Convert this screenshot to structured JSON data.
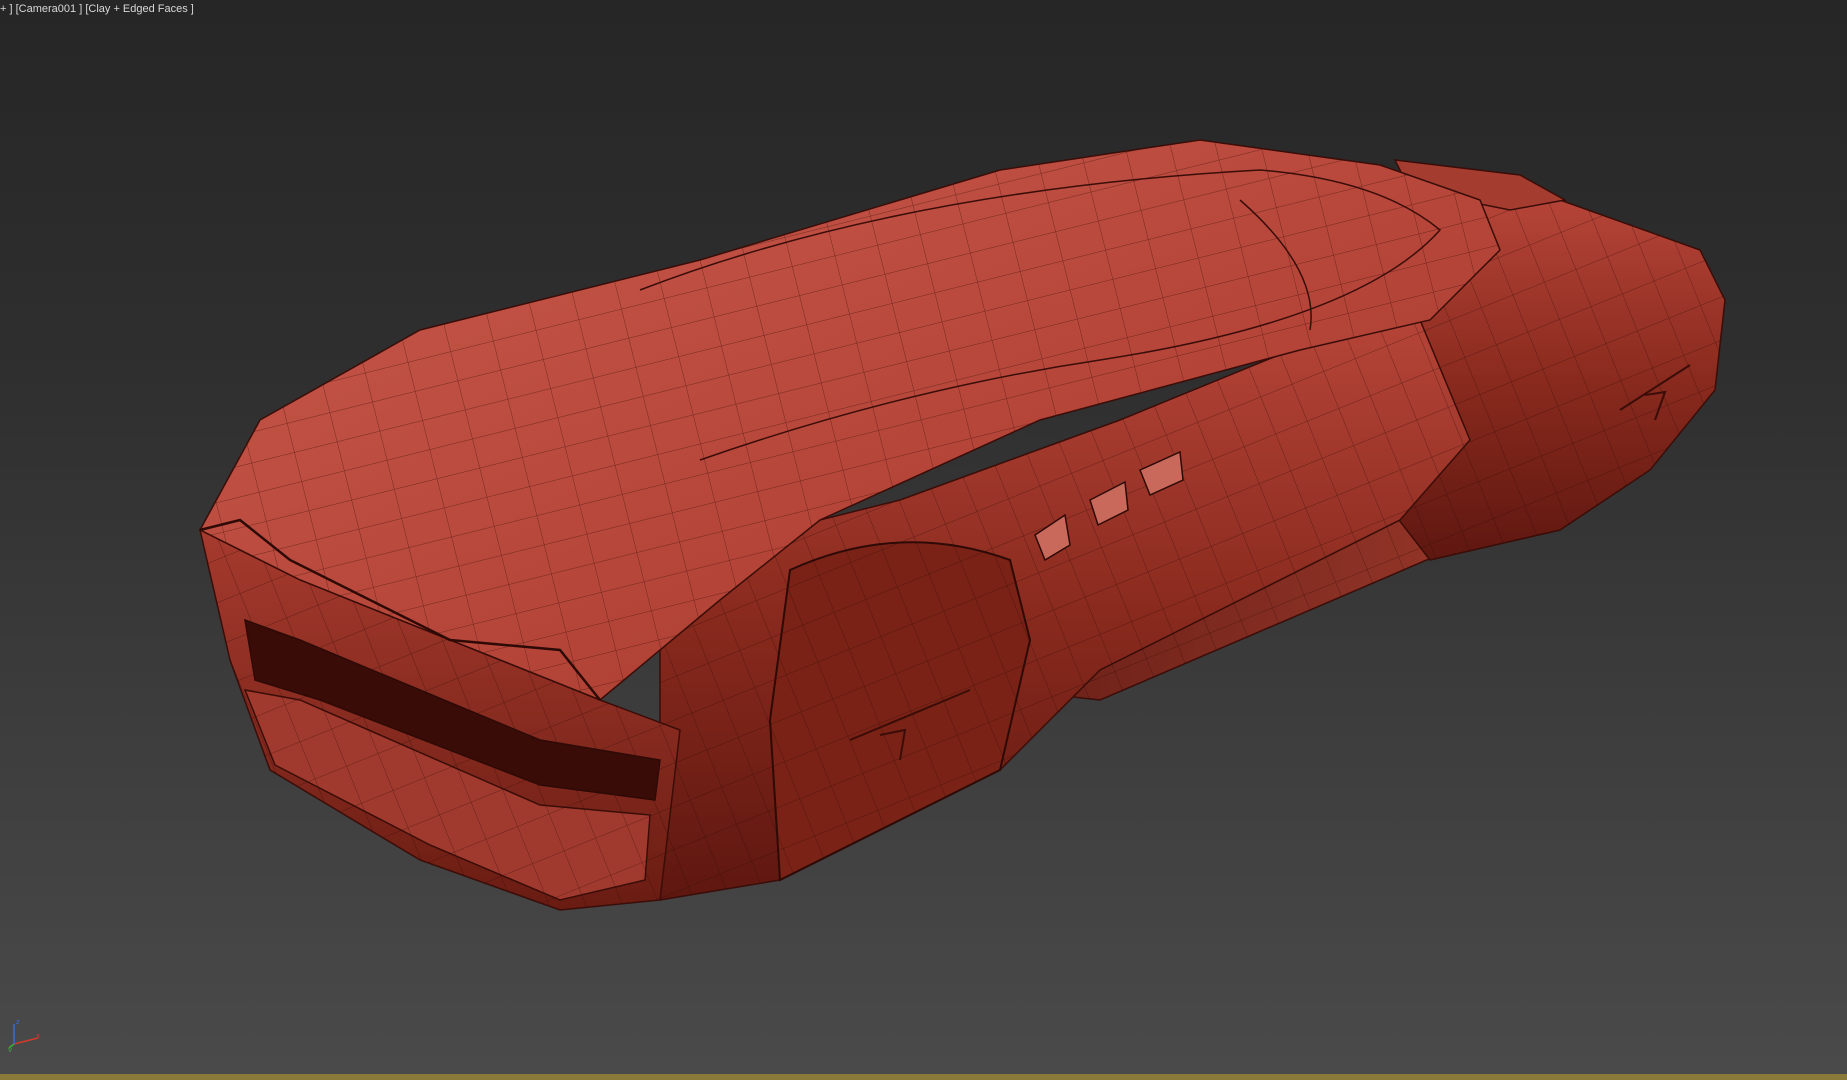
{
  "viewport": {
    "menu_plus": "+ ]",
    "camera_label": "[Camera001 ]",
    "shading_label": "[Clay + Edged Faces ]"
  },
  "model": {
    "color_base": "#b5453a",
    "color_dark": "#5e1710",
    "color_light": "#c9594b",
    "wire_color": "#3a0d08"
  },
  "gizmo": {
    "x_label": "x",
    "y_label": "y",
    "z_label": "z",
    "x_color": "#d43a2a",
    "y_color": "#3cb03c",
    "z_color": "#3a6ad4"
  },
  "status": {
    "border_color": "#8a7a3a"
  }
}
